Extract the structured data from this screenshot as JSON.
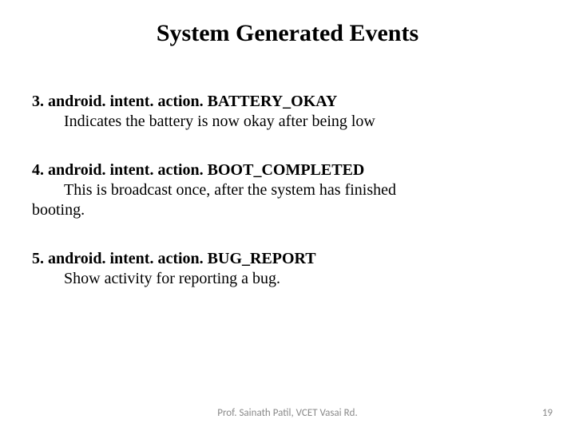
{
  "title": "System Generated Events",
  "items": [
    {
      "heading": "3. android. intent. action. BATTERY_OKAY",
      "description": "Indicates the battery is now okay after being low"
    },
    {
      "heading": "4. android. intent. action. BOOT_COMPLETED",
      "desc_line1": "This is broadcast once, after the system has finished",
      "desc_line2": "booting."
    },
    {
      "heading": "5. android. intent. action. BUG_REPORT",
      "description": "Show activity for reporting a bug."
    }
  ],
  "footer": "Prof. Sainath Patil, VCET Vasai Rd.",
  "page_number": "19"
}
